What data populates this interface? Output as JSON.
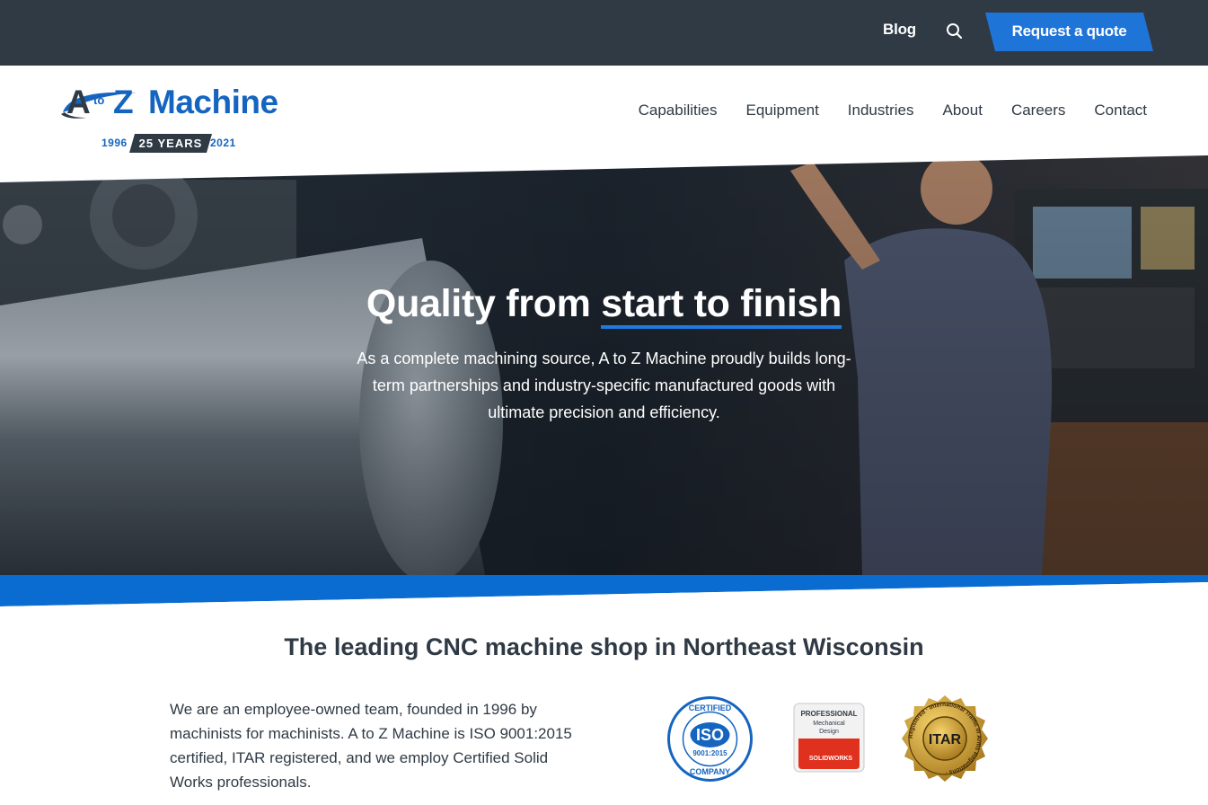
{
  "topbar": {
    "blog_label": "Blog",
    "search_icon": "search-icon",
    "quote_label": "Request a quote"
  },
  "logo": {
    "a": "A",
    "to": "to",
    "z": "Z",
    "machine": "Machine",
    "year_start": "1996",
    "badge": "25 YEARS",
    "year_end": "2021"
  },
  "nav": {
    "items": [
      "Capabilities",
      "Equipment",
      "Industries",
      "About",
      "Careers",
      "Contact"
    ]
  },
  "hero": {
    "title_plain": "Quality from ",
    "title_accent": "start to finish",
    "subtitle": "As a complete machining source, A to Z Machine proudly builds long-term partnerships and industry-specific manufactured goods with ultimate precision and efficiency."
  },
  "main": {
    "section_title": "The leading CNC machine shop in Northeast Wisconsin",
    "intro": "We are an employee-owned team, founded in 1996 by machinists for machinists. A to Z Machine is ISO 9001:2015 certified, ITAR registered, and we employ Certified Solid Works professionals."
  },
  "certs": {
    "iso": {
      "top": "CERTIFIED",
      "center": "ISO",
      "number": "9001:2015",
      "bottom": "COMPANY"
    },
    "solidworks": {
      "line1": "PROFESSIONAL",
      "line2": "Mechanical",
      "line3": "Design",
      "brand": "SOLIDWORKS"
    },
    "itar": {
      "center": "ITAR",
      "ring": "Registered · International Traffic in Arms Regulations ·"
    }
  },
  "colors": {
    "topbar": "#2f3a45",
    "brand_blue": "#1565c0",
    "accent_blue": "#1f7ae0"
  }
}
